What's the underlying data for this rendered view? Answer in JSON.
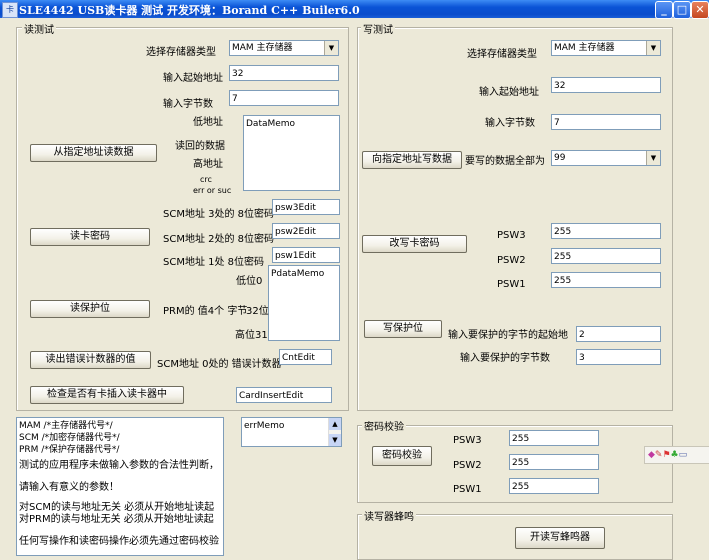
{
  "window": {
    "title": "SLE4442 USB读卡器 测试  开发环境：Borand  C++ Builer6.0",
    "app_icon": "卡"
  },
  "read": {
    "group_label": "读测试",
    "mem_type_label": "选择存储器类型",
    "mem_type_value": "MAM 主存储器",
    "start_addr_label": "输入起始地址",
    "start_addr_value": "32",
    "byte_count_label": "输入字节数",
    "byte_count_value": "7",
    "low_addr_label": "低地址",
    "read_data_label": "读回的数据",
    "high_addr_label": "高地址",
    "crc_label": "crc",
    "err_label": "err or suc",
    "data_memo": "DataMemo",
    "read_btn": "从指定地址读数据",
    "psw3_label": "SCM地址 3处的 8位密码",
    "psw3_value": "psw3Edit",
    "psw2_label": "SCM地址 2处的 8位密码",
    "psw2_value": "psw2Edit",
    "psw1_label": "SCM地址 1处 8位密码",
    "psw1_value": "psw1Edit",
    "read_pwd_btn": "读卡密码",
    "prm_low_label": "低位0",
    "prm_label": "PRM的 值4个 字节",
    "prm_mid_label": "32位",
    "prm_high_label": "高位31",
    "pdata_memo": "PdataMemo",
    "read_protect_btn": "读保护位",
    "err_counter_btn": "读出错误计数器的值",
    "err_counter_label": "SCM地址 0处的 错误计数器",
    "err_counter_value": "CntEdit",
    "check_card_btn": "检查是否有卡插入读卡器中",
    "card_insert_value": "CardInsertEdit"
  },
  "write": {
    "group_label": "写测试",
    "mem_type_label": "选择存储器类型",
    "mem_type_value": "MAM 主存储器",
    "start_addr_label": "输入起始地址",
    "start_addr_value": "32",
    "byte_count_label": "输入字节数",
    "byte_count_value": "7",
    "write_btn": "向指定地址写数据",
    "fill_label": "要写的数据全部为",
    "fill_value": "99",
    "change_pwd_btn": "改写卡密码",
    "psw3_label": "PSW3",
    "psw3_value": "255",
    "psw2_label": "PSW2",
    "psw2_value": "255",
    "psw1_label": "PSW1",
    "psw1_value": "255",
    "write_protect_btn": "写保护位",
    "protect_start_label": "输入要保护的字节的起始地",
    "protect_start_value": "2",
    "protect_count_label": "输入要保护的字节数",
    "protect_count_value": "3"
  },
  "info_memo": {
    "lines": [
      "MAM     /*主存储器代号*/",
      "SCM     /*加密存储器代号*/",
      "PRM     /*保护存储器代号*/",
      "测试的应用程序未做输入参数的合法性判断，",
      "请输入有意义的参数！",
      "对SCM的读与地址无关 必须从开始地址读起",
      "对PRM的读与地址无关 必须从开始地址读起",
      "任何写操作和读密码操作必须先通过密码校验"
    ]
  },
  "err_memo": "errMemo",
  "verify": {
    "group_label": "密码校验",
    "btn": "密码校验",
    "psw3_label": "PSW3",
    "psw3_value": "255",
    "psw2_label": "PSW2",
    "psw2_value": "255",
    "psw1_label": "PSW1",
    "psw1_value": "255"
  },
  "buzzer": {
    "group_label": "读写器蜂鸣",
    "btn": "开读写蜂鸣器"
  },
  "icons": {
    "minimize": "_",
    "maximize": "□",
    "close": "✕",
    "arrow_down": "▼",
    "arrow_up": "▲"
  }
}
